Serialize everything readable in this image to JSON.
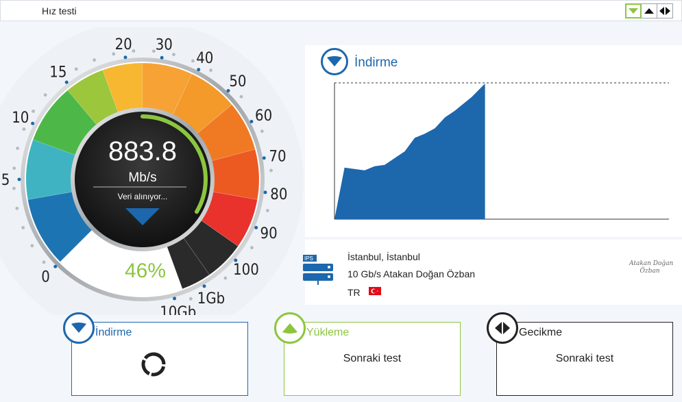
{
  "window": {
    "title": "Hız testi"
  },
  "window_controls": [
    {
      "name": "download-mode",
      "icon": "triangle-down-icon"
    },
    {
      "name": "upload-mode",
      "icon": "triangle-up-icon"
    },
    {
      "name": "latency-mode",
      "icon": "left-right-arrows-icon"
    }
  ],
  "gauge": {
    "value": "883.8",
    "unit": "Mb/s",
    "status": "Veri alınıyor...",
    "percent": "46%",
    "progress": 0.46,
    "tick_labels": [
      "0",
      "5",
      "10",
      "15",
      "20",
      "30",
      "40",
      "50",
      "60",
      "70",
      "80",
      "90",
      "100",
      "1Gb",
      "10Gb"
    ],
    "colors": {
      "blue": "#1d67ad",
      "green": "#8cc63f",
      "orange": "#f39a2b",
      "red": "#e8322b"
    }
  },
  "graph": {
    "title": "İndirme",
    "icon": "triangle-down-icon",
    "fill_color": "#1d67ad"
  },
  "chart_data": {
    "type": "area",
    "title": "İndirme",
    "xlabel": "",
    "ylabel": "",
    "x": [
      0,
      3,
      6,
      9,
      12,
      15,
      18,
      21,
      24,
      27,
      30,
      33,
      36,
      38,
      41,
      45
    ],
    "values": [
      0,
      38,
      37,
      36,
      39,
      40,
      45,
      50,
      60,
      63,
      67,
      75,
      80,
      84,
      90,
      100
    ],
    "xlim": [
      0,
      100
    ],
    "ylim": [
      0,
      100
    ],
    "grid": false,
    "annotations": [
      "dashed max line"
    ]
  },
  "server": {
    "badge": "IPS",
    "location": "İstanbul, İstanbul",
    "provider": "10 Gb/s Atakan Doğan Özban",
    "country": "TR",
    "signature": "Atakan Doğan Özban"
  },
  "cards": {
    "download": {
      "label": "İndirme",
      "status_icon": "refresh-icon",
      "color": "#1d67ad"
    },
    "upload": {
      "label": "Yükleme",
      "status": "Sonraki test",
      "color": "#8cc63f"
    },
    "latency": {
      "label": "Gecikme",
      "status": "Sonraki test",
      "color": "#222222"
    }
  }
}
